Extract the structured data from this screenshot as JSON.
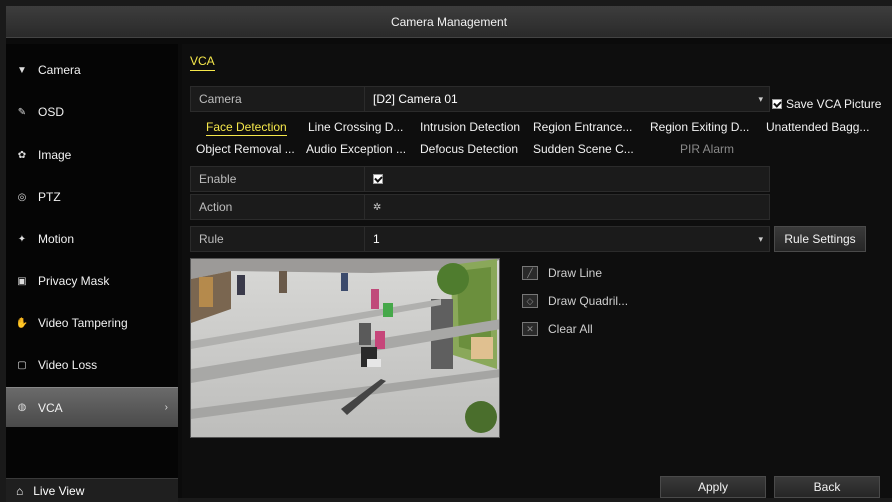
{
  "window": {
    "title": "Camera Management"
  },
  "sidebar": {
    "items": [
      {
        "label": "Camera",
        "icon": "camera-icon",
        "glyph": "▼"
      },
      {
        "label": "OSD",
        "icon": "osd-icon",
        "glyph": "✎"
      },
      {
        "label": "Image",
        "icon": "image-icon",
        "glyph": "✿"
      },
      {
        "label": "PTZ",
        "icon": "ptz-icon",
        "glyph": "◎"
      },
      {
        "label": "Motion",
        "icon": "motion-icon",
        "glyph": "🏃"
      },
      {
        "label": "Privacy Mask",
        "icon": "privacy-mask-icon",
        "glyph": "▣"
      },
      {
        "label": "Video Tampering",
        "icon": "video-tampering-icon",
        "glyph": "✋"
      },
      {
        "label": "Video Loss",
        "icon": "video-loss-icon",
        "glyph": "▢"
      },
      {
        "label": "VCA",
        "icon": "vca-icon",
        "glyph": "◍",
        "active": true
      }
    ],
    "live_view": "Live View"
  },
  "main": {
    "tab": "VCA",
    "camera_label": "Camera",
    "camera_value": "[D2] Camera 01",
    "save_vca_picture": "Save VCA Picture",
    "func_tabs_row1": [
      "Face Detection",
      "Line Crossing D...",
      "Intrusion Detection",
      "Region Entrance...",
      "Region Exiting D...",
      "Unattended Bagg..."
    ],
    "func_tabs_row2": [
      "Object Removal ...",
      "Audio Exception ...",
      "Defocus Detection",
      "Sudden Scene C...",
      "PIR Alarm"
    ],
    "selected_tab": "Face Detection",
    "disabled_tab": "PIR Alarm",
    "enable_label": "Enable",
    "action_label": "Action",
    "rule_label": "Rule",
    "rule_value": "1",
    "rule_settings": "Rule Settings",
    "tools": [
      "Draw Line",
      "Draw Quadril...",
      "Clear All"
    ],
    "apply": "Apply",
    "back": "Back"
  },
  "colors": {
    "accent": "#f6e84b",
    "background": "#0e0e0e",
    "panel": "#1b1b1b"
  }
}
